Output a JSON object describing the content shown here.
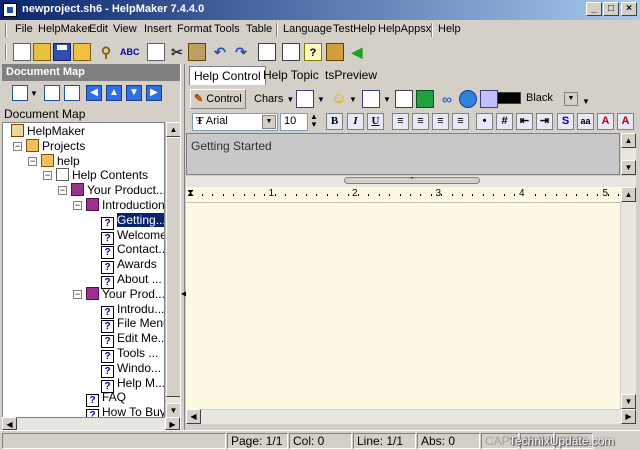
{
  "window": {
    "title": "newproject.sh6 - HelpMaker 7.4.4.0"
  },
  "menu": [
    "File",
    "HelpMaker",
    "Edit",
    "View",
    "Insert",
    "Format",
    "Tools",
    "Table",
    "Language",
    "TestHelp",
    "HelpAppsx",
    "Help"
  ],
  "doc_map": {
    "header": "Document Map",
    "label": "Document Map",
    "tree": [
      {
        "label": "HelpMaker",
        "level": 0,
        "icon": "house-icon",
        "toggle": ""
      },
      {
        "label": "Projects",
        "level": 1,
        "icon": "projects-icon",
        "toggle": "−"
      },
      {
        "label": "help",
        "level": 2,
        "icon": "project-icon",
        "toggle": "−"
      },
      {
        "label": "Help Contents",
        "level": 3,
        "icon": "contents-icon",
        "toggle": "−"
      },
      {
        "label": "Your Product...",
        "level": 4,
        "icon": "book-icon",
        "toggle": "−"
      },
      {
        "label": "Introduction",
        "level": 5,
        "icon": "book-icon",
        "toggle": "−"
      },
      {
        "label": "Getting...",
        "level": 6,
        "icon": "help-topic-icon",
        "toggle": "",
        "selected": true
      },
      {
        "label": "Welcome...",
        "level": 6,
        "icon": "help-topic-icon",
        "toggle": ""
      },
      {
        "label": "Contact...",
        "level": 6,
        "icon": "help-topic-icon",
        "toggle": ""
      },
      {
        "label": "Awards",
        "level": 6,
        "icon": "help-topic-icon",
        "toggle": ""
      },
      {
        "label": "About ...",
        "level": 6,
        "icon": "help-topic-icon",
        "toggle": ""
      },
      {
        "label": "Your Prod...",
        "level": 5,
        "icon": "book-icon",
        "toggle": "−"
      },
      {
        "label": "Introdu...",
        "level": 6,
        "icon": "help-topic-icon",
        "toggle": ""
      },
      {
        "label": "File Menu",
        "level": 6,
        "icon": "help-topic-icon",
        "toggle": ""
      },
      {
        "label": "Edit Me...",
        "level": 6,
        "icon": "help-topic-icon",
        "toggle": ""
      },
      {
        "label": "Tools ...",
        "level": 6,
        "icon": "help-topic-icon",
        "toggle": ""
      },
      {
        "label": "Windo...",
        "level": 6,
        "icon": "help-topic-icon",
        "toggle": ""
      },
      {
        "label": "Help M...",
        "level": 6,
        "icon": "help-topic-icon",
        "toggle": ""
      },
      {
        "label": "FAQ",
        "level": 5,
        "icon": "help-topic-icon",
        "toggle": ""
      },
      {
        "label": "How To Buy",
        "level": 5,
        "icon": "help-topic-icon",
        "toggle": ""
      }
    ]
  },
  "tabs": [
    "Help Control",
    "Help Topic",
    "tsPreview"
  ],
  "editor_toolbar": {
    "control_label": "Control",
    "chars_label": "Chars",
    "color_label": "Black",
    "color_value": "#000000"
  },
  "format_toolbar": {
    "font": "Arial",
    "size": "10",
    "buttons": [
      "B",
      "I",
      "U",
      "S",
      "aa",
      "A"
    ]
  },
  "topic": {
    "title": "Getting Started"
  },
  "ruler": {
    "labels": [
      "1",
      "2",
      "3",
      "4",
      "5"
    ]
  },
  "status": {
    "page": "Page: 1/1",
    "col": "Col: 0",
    "line": "Line: 1/1",
    "abs": "Abs: 0",
    "caps": "CAPS",
    "num": "NUM",
    "scrl": "SCRL"
  },
  "watermark": "TechnixUpdate.com"
}
